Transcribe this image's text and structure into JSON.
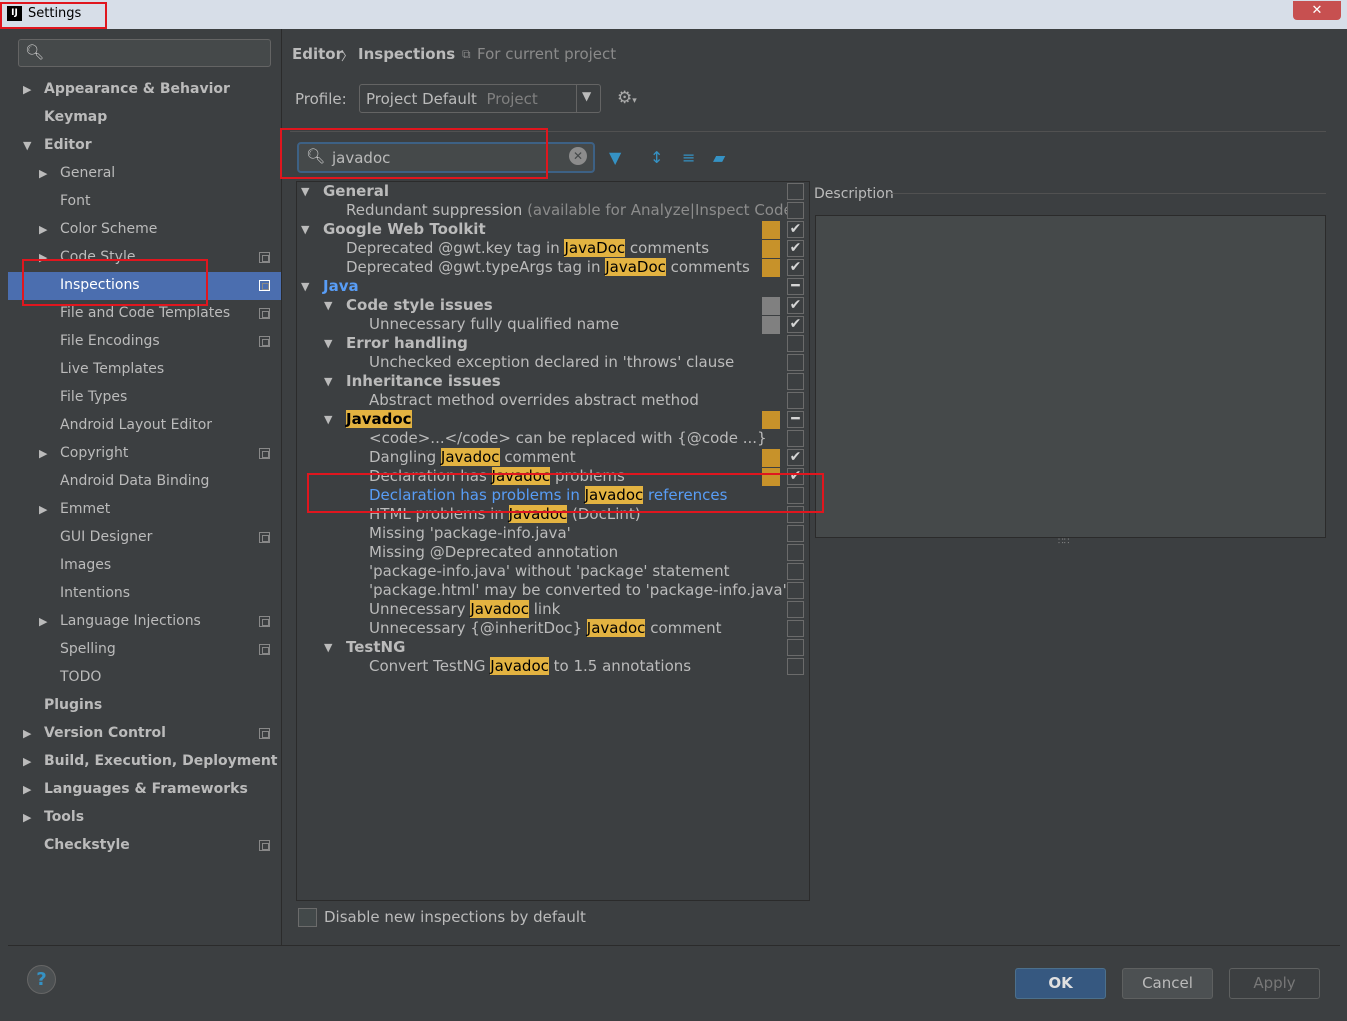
{
  "window": {
    "title": "Settings",
    "close": "✕",
    "app_icon": "IJ"
  },
  "left_tree": [
    {
      "label": "Appearance & Behavior",
      "level": 0,
      "arrow": "right",
      "bold": true
    },
    {
      "label": "Keymap",
      "level": 0,
      "arrow": "none",
      "bold": true
    },
    {
      "label": "Editor",
      "level": 0,
      "arrow": "down",
      "bold": true
    },
    {
      "label": "General",
      "level": 1,
      "arrow": "right"
    },
    {
      "label": "Font",
      "level": 1,
      "arrow": "none"
    },
    {
      "label": "Color Scheme",
      "level": 1,
      "arrow": "right"
    },
    {
      "label": "Code Style",
      "level": 1,
      "arrow": "right",
      "project": true
    },
    {
      "label": "Inspections",
      "level": 1,
      "arrow": "none",
      "project": true,
      "selected": true
    },
    {
      "label": "File and Code Templates",
      "level": 1,
      "arrow": "none",
      "project": true
    },
    {
      "label": "File Encodings",
      "level": 1,
      "arrow": "none",
      "project": true
    },
    {
      "label": "Live Templates",
      "level": 1,
      "arrow": "none"
    },
    {
      "label": "File Types",
      "level": 1,
      "arrow": "none"
    },
    {
      "label": "Android Layout Editor",
      "level": 1,
      "arrow": "none"
    },
    {
      "label": "Copyright",
      "level": 1,
      "arrow": "right",
      "project": true
    },
    {
      "label": "Android Data Binding",
      "level": 1,
      "arrow": "none"
    },
    {
      "label": "Emmet",
      "level": 1,
      "arrow": "right"
    },
    {
      "label": "GUI Designer",
      "level": 1,
      "arrow": "none",
      "project": true
    },
    {
      "label": "Images",
      "level": 1,
      "arrow": "none"
    },
    {
      "label": "Intentions",
      "level": 1,
      "arrow": "none"
    },
    {
      "label": "Language Injections",
      "level": 1,
      "arrow": "right",
      "project": true
    },
    {
      "label": "Spelling",
      "level": 1,
      "arrow": "none",
      "project": true
    },
    {
      "label": "TODO",
      "level": 1,
      "arrow": "none"
    },
    {
      "label": "Plugins",
      "level": 0,
      "arrow": "none",
      "bold": true
    },
    {
      "label": "Version Control",
      "level": 0,
      "arrow": "right",
      "bold": true,
      "project": true
    },
    {
      "label": "Build, Execution, Deployment",
      "level": 0,
      "arrow": "right",
      "bold": true
    },
    {
      "label": "Languages & Frameworks",
      "level": 0,
      "arrow": "right",
      "bold": true
    },
    {
      "label": "Tools",
      "level": 0,
      "arrow": "right",
      "bold": true
    },
    {
      "label": "Checkstyle",
      "level": 0,
      "arrow": "none",
      "bold": true,
      "project": true
    }
  ],
  "breadcrumb": {
    "editor": "Editor",
    "sep": "〉",
    "inspections": "Inspections",
    "scope": "For current project"
  },
  "profile": {
    "label": "Profile:",
    "value": "Project Default",
    "value_suffix": "Project"
  },
  "filter": {
    "value": "javadoc"
  },
  "inspections": [
    {
      "parts": [
        "General"
      ],
      "level": 0,
      "arrow": "down",
      "bold": true,
      "sev": "",
      "check": "empty"
    },
    {
      "parts": [
        "Redundant suppression ",
        "",
        "(available for Analyze|Inspect Code)"
      ],
      "level": 1,
      "arrow": "none",
      "gray_tail": true,
      "sev": "",
      "check": "empty"
    },
    {
      "parts": [
        "Google Web Toolkit"
      ],
      "level": 0,
      "arrow": "down",
      "bold": true,
      "sev": "yellow",
      "check": "checked"
    },
    {
      "parts": [
        "Deprecated @gwt.key tag in ",
        "JavaDoc",
        " comments"
      ],
      "level": 1,
      "arrow": "none",
      "sev": "yellow",
      "check": "checked"
    },
    {
      "parts": [
        "Deprecated @gwt.typeArgs tag in ",
        "JavaDoc",
        " comments"
      ],
      "level": 1,
      "arrow": "none",
      "sev": "yellow",
      "check": "checked"
    },
    {
      "parts": [
        "Java"
      ],
      "level": 0,
      "arrow": "down",
      "bold": true,
      "blue": true,
      "sev": "",
      "check": "partial"
    },
    {
      "parts": [
        "Code style issues"
      ],
      "level": 1,
      "arrow": "down",
      "bold": true,
      "sev": "gray",
      "check": "checked"
    },
    {
      "parts": [
        "Unnecessary fully qualified name"
      ],
      "level": 2,
      "arrow": "none",
      "sev": "gray",
      "check": "checked"
    },
    {
      "parts": [
        "Error handling"
      ],
      "level": 1,
      "arrow": "down",
      "bold": true,
      "sev": "",
      "check": "empty"
    },
    {
      "parts": [
        "Unchecked exception declared in 'throws' clause"
      ],
      "level": 2,
      "arrow": "none",
      "sev": "",
      "check": "empty"
    },
    {
      "parts": [
        "Inheritance issues"
      ],
      "level": 1,
      "arrow": "down",
      "bold": true,
      "sev": "",
      "check": "empty"
    },
    {
      "parts": [
        "Abstract method overrides abstract method"
      ],
      "level": 2,
      "arrow": "none",
      "sev": "",
      "check": "empty"
    },
    {
      "parts": [
        "",
        "Javadoc",
        ""
      ],
      "level": 1,
      "arrow": "down",
      "bold": true,
      "sev": "yellow",
      "check": "partial"
    },
    {
      "parts": [
        "<code>...</code> can be replaced with {@code ...}"
      ],
      "level": 2,
      "arrow": "none",
      "sev": "",
      "check": "empty"
    },
    {
      "parts": [
        "Dangling ",
        "Javadoc",
        " comment"
      ],
      "level": 2,
      "arrow": "none",
      "sev": "yellow",
      "check": "checked"
    },
    {
      "parts": [
        "Declaration has ",
        "Javadoc",
        " problems"
      ],
      "level": 2,
      "arrow": "none",
      "sev": "yellow",
      "check": "checked"
    },
    {
      "parts": [
        "Declaration has problems in ",
        "Javadoc",
        " references"
      ],
      "level": 2,
      "arrow": "none",
      "blue": true,
      "sev": "",
      "check": "empty"
    },
    {
      "parts": [
        "HTML problems in ",
        "Javadoc",
        " (DocLint)"
      ],
      "level": 2,
      "arrow": "none",
      "sev": "",
      "check": "empty"
    },
    {
      "parts": [
        "Missing 'package-info.java'"
      ],
      "level": 2,
      "arrow": "none",
      "sev": "",
      "check": "empty"
    },
    {
      "parts": [
        "Missing @Deprecated annotation"
      ],
      "level": 2,
      "arrow": "none",
      "sev": "",
      "check": "empty"
    },
    {
      "parts": [
        "'package-info.java' without 'package' statement"
      ],
      "level": 2,
      "arrow": "none",
      "sev": "",
      "check": "empty"
    },
    {
      "parts": [
        "'package.html' may be converted to 'package-info.java'"
      ],
      "level": 2,
      "arrow": "none",
      "sev": "",
      "check": "empty"
    },
    {
      "parts": [
        "Unnecessary ",
        "Javadoc",
        " link"
      ],
      "level": 2,
      "arrow": "none",
      "sev": "",
      "check": "empty"
    },
    {
      "parts": [
        "Unnecessary {@inheritDoc} ",
        "Javadoc",
        " comment"
      ],
      "level": 2,
      "arrow": "none",
      "sev": "",
      "check": "empty"
    },
    {
      "parts": [
        "TestNG"
      ],
      "level": 1,
      "arrow": "down",
      "bold": true,
      "sev": "",
      "check": "empty"
    },
    {
      "parts": [
        "Convert TestNG ",
        "Javadoc",
        " to 1.5 annotations"
      ],
      "level": 2,
      "arrow": "none",
      "sev": "",
      "check": "empty"
    }
  ],
  "description": {
    "label": "Description"
  },
  "disable_new": {
    "label": "Disable new inspections by default"
  },
  "buttons": {
    "ok": "OK",
    "cancel": "Cancel",
    "apply": "Apply",
    "help": "?"
  },
  "colors": {
    "selection": "#4b6eaf",
    "highlight": "#e3b341",
    "link": "#589df6",
    "warning": "#c7922a"
  }
}
